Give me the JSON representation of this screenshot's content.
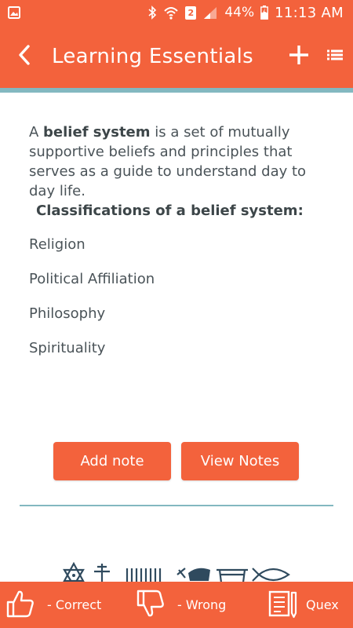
{
  "status_bar": {
    "battery": "44%",
    "time": "11:13 AM",
    "sim": "2",
    "icons": [
      "image-icon",
      "bluetooth-icon",
      "wifi-icon",
      "sim-icon",
      "signal-icon",
      "battery-icon"
    ]
  },
  "app_bar": {
    "title": "Learning Essentials",
    "icons": [
      "back-arrow-icon",
      "plus-icon",
      "list-icon"
    ]
  },
  "content": {
    "intro_prefix": "A ",
    "intro_term": "belief system",
    "intro_rest": " is a set of mutually supportive beliefs and principles that serves as a guide to understand day to day life.",
    "classifications_heading": "Classifications of a belief system:",
    "classifications": [
      "Religion",
      "Political Affiliation",
      "Philosophy",
      "Spirituality"
    ]
  },
  "buttons": {
    "add_note": "Add note",
    "view_notes": "View Notes"
  },
  "bottom_bar": {
    "correct_label": "- Correct",
    "wrong_label": "- Wrong",
    "quex_label": "Quex",
    "icons": [
      "thumbs-up-icon",
      "thumbs-down-icon",
      "notebook-pencil-icon"
    ]
  },
  "colors": {
    "primary": "#f3623c",
    "accent": "#83b8c0",
    "text": "#4a5358",
    "symbols": "#2f4a5e"
  }
}
